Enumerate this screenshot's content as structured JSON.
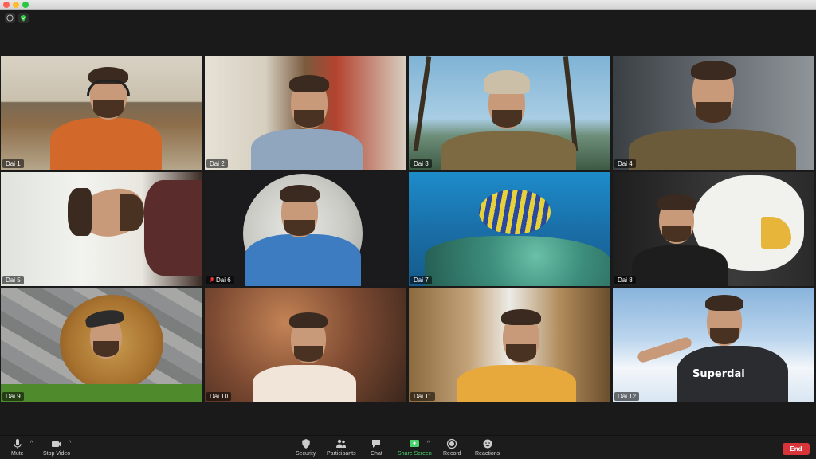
{
  "window": {
    "controls": [
      "close",
      "minimize",
      "maximize"
    ]
  },
  "top_icons": [
    {
      "icon": "info-icon"
    },
    {
      "icon": "shield-icon",
      "color": "#2ecc40"
    }
  ],
  "participants": [
    {
      "name": "Dai 1",
      "muted": false,
      "bg": "bookshelf"
    },
    {
      "name": "Dai 2",
      "muted": false,
      "bg": "bookshelf"
    },
    {
      "name": "Dai 3",
      "muted": false,
      "bg": "palm-beach"
    },
    {
      "name": "Dai 4",
      "muted": false,
      "bg": "lunch-sign"
    },
    {
      "name": "Dai 5",
      "muted": false,
      "bg": "white-room"
    },
    {
      "name": "Dai 6",
      "muted": true,
      "bg": "moon"
    },
    {
      "name": "Dai 7",
      "muted": false,
      "bg": "coral-reef"
    },
    {
      "name": "Dai 8",
      "muted": false,
      "bg": "eagle"
    },
    {
      "name": "Dai 9",
      "muted": false,
      "bg": "lion",
      "active_speaker": true
    },
    {
      "name": "Dai 10",
      "muted": false,
      "bg": "brick-bar"
    },
    {
      "name": "Dai 11",
      "muted": false,
      "bg": "kitchen"
    },
    {
      "name": "Dai 12",
      "muted": false,
      "bg": "clouds"
    }
  ],
  "toolbar": {
    "mute": "Mute",
    "stop_video": "Stop Video",
    "security": "Security",
    "participants": "Participants",
    "chat": "Chat",
    "share_screen": "Share Screen",
    "record": "Record",
    "reactions": "Reactions",
    "end": "End"
  },
  "colors": {
    "active_speaker": "#c8f53b",
    "share": "#4ad36b",
    "end": "#d8353a"
  }
}
